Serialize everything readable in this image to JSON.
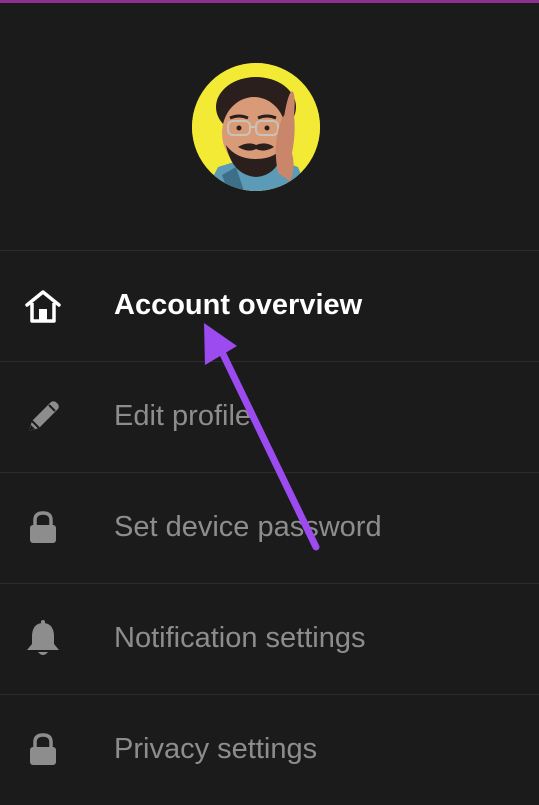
{
  "colors": {
    "background": "#1b1b1c",
    "active_text": "#ffffff",
    "inactive_text": "#8d8d8e",
    "divider": "#2c2c2d",
    "top_strip": "#8e2f93",
    "avatar_background": "#f2ea34",
    "annotation_arrow": "#9b4bf0"
  },
  "profile": {
    "avatar_icon": "avatar-cartoon-portrait"
  },
  "menu": {
    "items": [
      {
        "label": "Account overview",
        "icon": "home-icon",
        "active": true
      },
      {
        "label": "Edit profile",
        "icon": "pencil-icon",
        "active": false
      },
      {
        "label": "Set device password",
        "icon": "lock-icon",
        "active": false
      },
      {
        "label": "Notification settings",
        "icon": "bell-icon",
        "active": false
      },
      {
        "label": "Privacy settings",
        "icon": "lock-icon",
        "active": false
      }
    ]
  }
}
